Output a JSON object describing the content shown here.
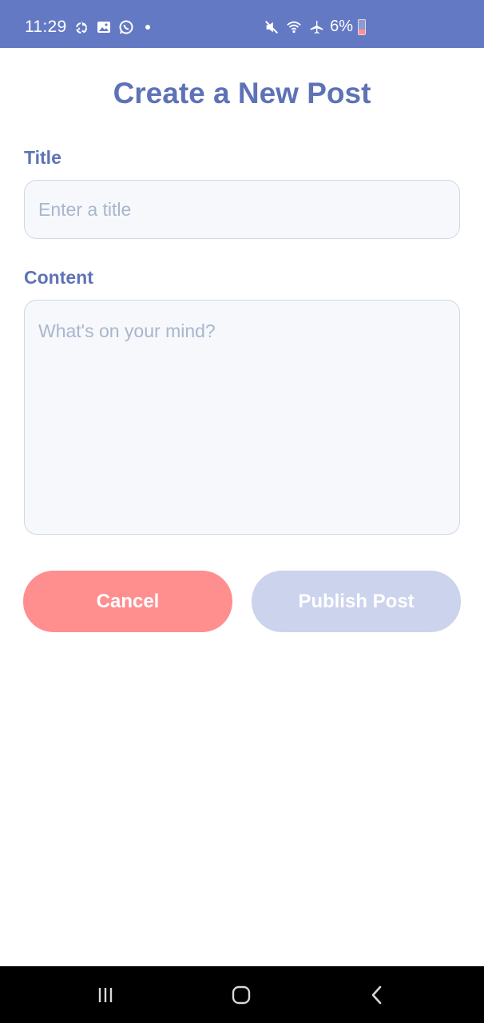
{
  "status_bar": {
    "time": "11:29",
    "left_icons": [
      "recycle-icon",
      "gallery-icon",
      "whatsapp-icon",
      "notification-dot"
    ],
    "right_icons": [
      "mute-icon",
      "wifi-icon",
      "airplane-icon"
    ],
    "battery_text": "6%",
    "background": "#6479c4"
  },
  "page": {
    "title": "Create a New Post"
  },
  "form": {
    "title_label": "Title",
    "title_value": "",
    "title_placeholder": "Enter a title",
    "content_label": "Content",
    "content_value": "",
    "content_placeholder": "What's on your mind?"
  },
  "actions": {
    "cancel_label": "Cancel",
    "publish_label": "Publish Post",
    "cancel_color": "#ff8f8f",
    "publish_color": "#ccd3ec"
  },
  "nav_bar": {
    "icons": [
      "recents-icon",
      "home-icon",
      "back-icon"
    ]
  },
  "colors": {
    "accent": "#5e72b6",
    "input_background": "#f6f8fc",
    "input_border": "#cfd8e6"
  }
}
